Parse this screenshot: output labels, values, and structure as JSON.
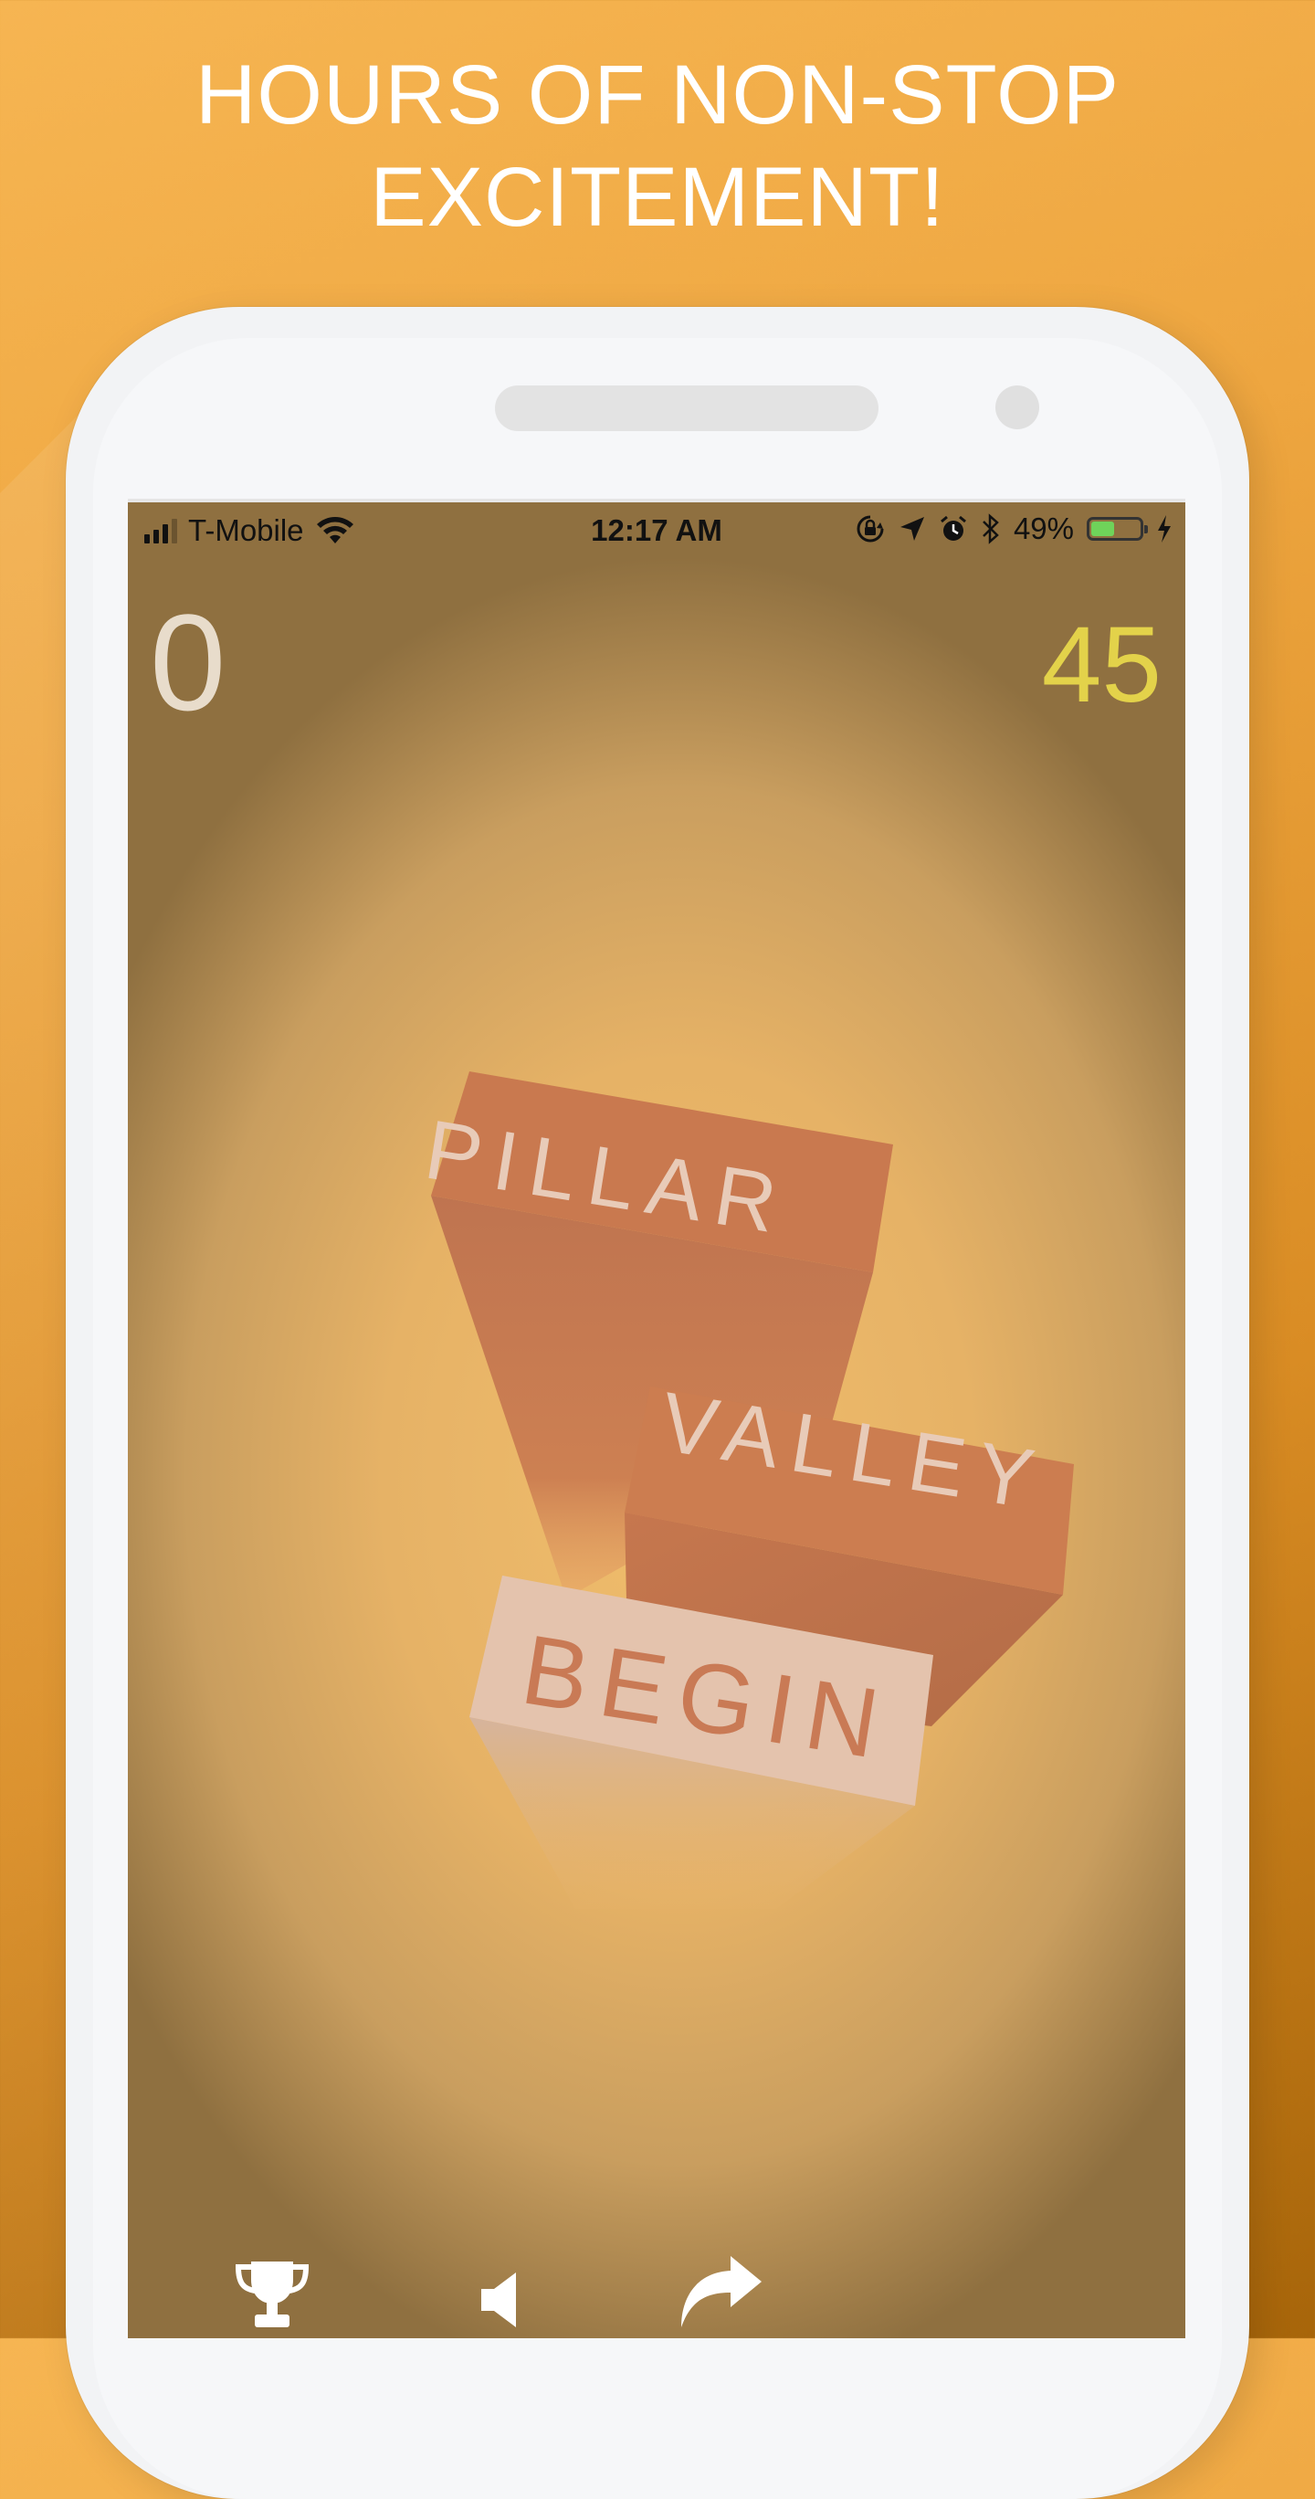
{
  "headline": {
    "line1": "HOURS OF NON-STOP",
    "line2": "EXCITEMENT!"
  },
  "status_bar": {
    "carrier": "T-Mobile",
    "time": "12:17 AM",
    "battery_percent": "49%",
    "battery_level": 0.49,
    "icons": [
      "signal-icon",
      "wifi-icon",
      "rotation-lock-icon",
      "location-arrow-icon",
      "alarm-icon",
      "bluetooth-icon",
      "battery-icon",
      "charging-bolt-icon"
    ]
  },
  "game": {
    "score": "0",
    "timer": "45",
    "blocks": {
      "pillar": "PILLAR",
      "valley": "VALLEY",
      "begin": "BEGIN"
    }
  },
  "toolbar": {
    "icons": [
      "trophy-icon",
      "sound-icon",
      "share-icon"
    ]
  },
  "colors": {
    "background_top": "#f6b552",
    "background_bottom": "#a7650a",
    "score": "#e8dccb",
    "timer": "#e3d24a",
    "block": "#c8784c",
    "begin_block": "#e5c4ae"
  }
}
